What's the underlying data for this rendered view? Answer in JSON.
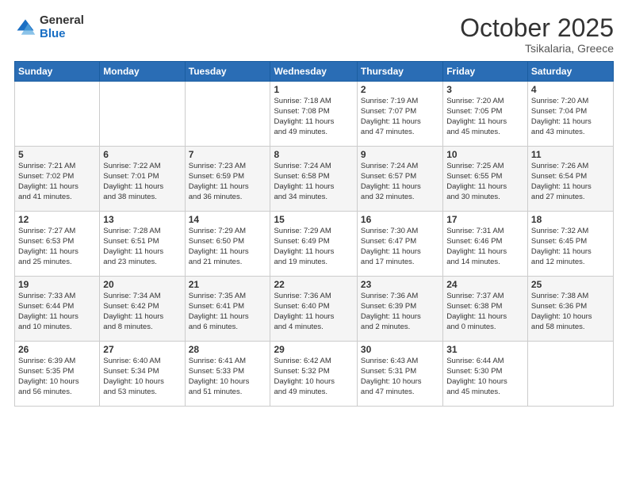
{
  "header": {
    "logo_general": "General",
    "logo_blue": "Blue",
    "month_title": "October 2025",
    "location": "Tsikalaria, Greece"
  },
  "weekdays": [
    "Sunday",
    "Monday",
    "Tuesday",
    "Wednesday",
    "Thursday",
    "Friday",
    "Saturday"
  ],
  "weeks": [
    [
      {
        "day": "",
        "info": ""
      },
      {
        "day": "",
        "info": ""
      },
      {
        "day": "",
        "info": ""
      },
      {
        "day": "1",
        "info": "Sunrise: 7:18 AM\nSunset: 7:08 PM\nDaylight: 11 hours\nand 49 minutes."
      },
      {
        "day": "2",
        "info": "Sunrise: 7:19 AM\nSunset: 7:07 PM\nDaylight: 11 hours\nand 47 minutes."
      },
      {
        "day": "3",
        "info": "Sunrise: 7:20 AM\nSunset: 7:05 PM\nDaylight: 11 hours\nand 45 minutes."
      },
      {
        "day": "4",
        "info": "Sunrise: 7:20 AM\nSunset: 7:04 PM\nDaylight: 11 hours\nand 43 minutes."
      }
    ],
    [
      {
        "day": "5",
        "info": "Sunrise: 7:21 AM\nSunset: 7:02 PM\nDaylight: 11 hours\nand 41 minutes."
      },
      {
        "day": "6",
        "info": "Sunrise: 7:22 AM\nSunset: 7:01 PM\nDaylight: 11 hours\nand 38 minutes."
      },
      {
        "day": "7",
        "info": "Sunrise: 7:23 AM\nSunset: 6:59 PM\nDaylight: 11 hours\nand 36 minutes."
      },
      {
        "day": "8",
        "info": "Sunrise: 7:24 AM\nSunset: 6:58 PM\nDaylight: 11 hours\nand 34 minutes."
      },
      {
        "day": "9",
        "info": "Sunrise: 7:24 AM\nSunset: 6:57 PM\nDaylight: 11 hours\nand 32 minutes."
      },
      {
        "day": "10",
        "info": "Sunrise: 7:25 AM\nSunset: 6:55 PM\nDaylight: 11 hours\nand 30 minutes."
      },
      {
        "day": "11",
        "info": "Sunrise: 7:26 AM\nSunset: 6:54 PM\nDaylight: 11 hours\nand 27 minutes."
      }
    ],
    [
      {
        "day": "12",
        "info": "Sunrise: 7:27 AM\nSunset: 6:53 PM\nDaylight: 11 hours\nand 25 minutes."
      },
      {
        "day": "13",
        "info": "Sunrise: 7:28 AM\nSunset: 6:51 PM\nDaylight: 11 hours\nand 23 minutes."
      },
      {
        "day": "14",
        "info": "Sunrise: 7:29 AM\nSunset: 6:50 PM\nDaylight: 11 hours\nand 21 minutes."
      },
      {
        "day": "15",
        "info": "Sunrise: 7:29 AM\nSunset: 6:49 PM\nDaylight: 11 hours\nand 19 minutes."
      },
      {
        "day": "16",
        "info": "Sunrise: 7:30 AM\nSunset: 6:47 PM\nDaylight: 11 hours\nand 17 minutes."
      },
      {
        "day": "17",
        "info": "Sunrise: 7:31 AM\nSunset: 6:46 PM\nDaylight: 11 hours\nand 14 minutes."
      },
      {
        "day": "18",
        "info": "Sunrise: 7:32 AM\nSunset: 6:45 PM\nDaylight: 11 hours\nand 12 minutes."
      }
    ],
    [
      {
        "day": "19",
        "info": "Sunrise: 7:33 AM\nSunset: 6:44 PM\nDaylight: 11 hours\nand 10 minutes."
      },
      {
        "day": "20",
        "info": "Sunrise: 7:34 AM\nSunset: 6:42 PM\nDaylight: 11 hours\nand 8 minutes."
      },
      {
        "day": "21",
        "info": "Sunrise: 7:35 AM\nSunset: 6:41 PM\nDaylight: 11 hours\nand 6 minutes."
      },
      {
        "day": "22",
        "info": "Sunrise: 7:36 AM\nSunset: 6:40 PM\nDaylight: 11 hours\nand 4 minutes."
      },
      {
        "day": "23",
        "info": "Sunrise: 7:36 AM\nSunset: 6:39 PM\nDaylight: 11 hours\nand 2 minutes."
      },
      {
        "day": "24",
        "info": "Sunrise: 7:37 AM\nSunset: 6:38 PM\nDaylight: 11 hours\nand 0 minutes."
      },
      {
        "day": "25",
        "info": "Sunrise: 7:38 AM\nSunset: 6:36 PM\nDaylight: 10 hours\nand 58 minutes."
      }
    ],
    [
      {
        "day": "26",
        "info": "Sunrise: 6:39 AM\nSunset: 5:35 PM\nDaylight: 10 hours\nand 56 minutes."
      },
      {
        "day": "27",
        "info": "Sunrise: 6:40 AM\nSunset: 5:34 PM\nDaylight: 10 hours\nand 53 minutes."
      },
      {
        "day": "28",
        "info": "Sunrise: 6:41 AM\nSunset: 5:33 PM\nDaylight: 10 hours\nand 51 minutes."
      },
      {
        "day": "29",
        "info": "Sunrise: 6:42 AM\nSunset: 5:32 PM\nDaylight: 10 hours\nand 49 minutes."
      },
      {
        "day": "30",
        "info": "Sunrise: 6:43 AM\nSunset: 5:31 PM\nDaylight: 10 hours\nand 47 minutes."
      },
      {
        "day": "31",
        "info": "Sunrise: 6:44 AM\nSunset: 5:30 PM\nDaylight: 10 hours\nand 45 minutes."
      },
      {
        "day": "",
        "info": ""
      }
    ]
  ]
}
